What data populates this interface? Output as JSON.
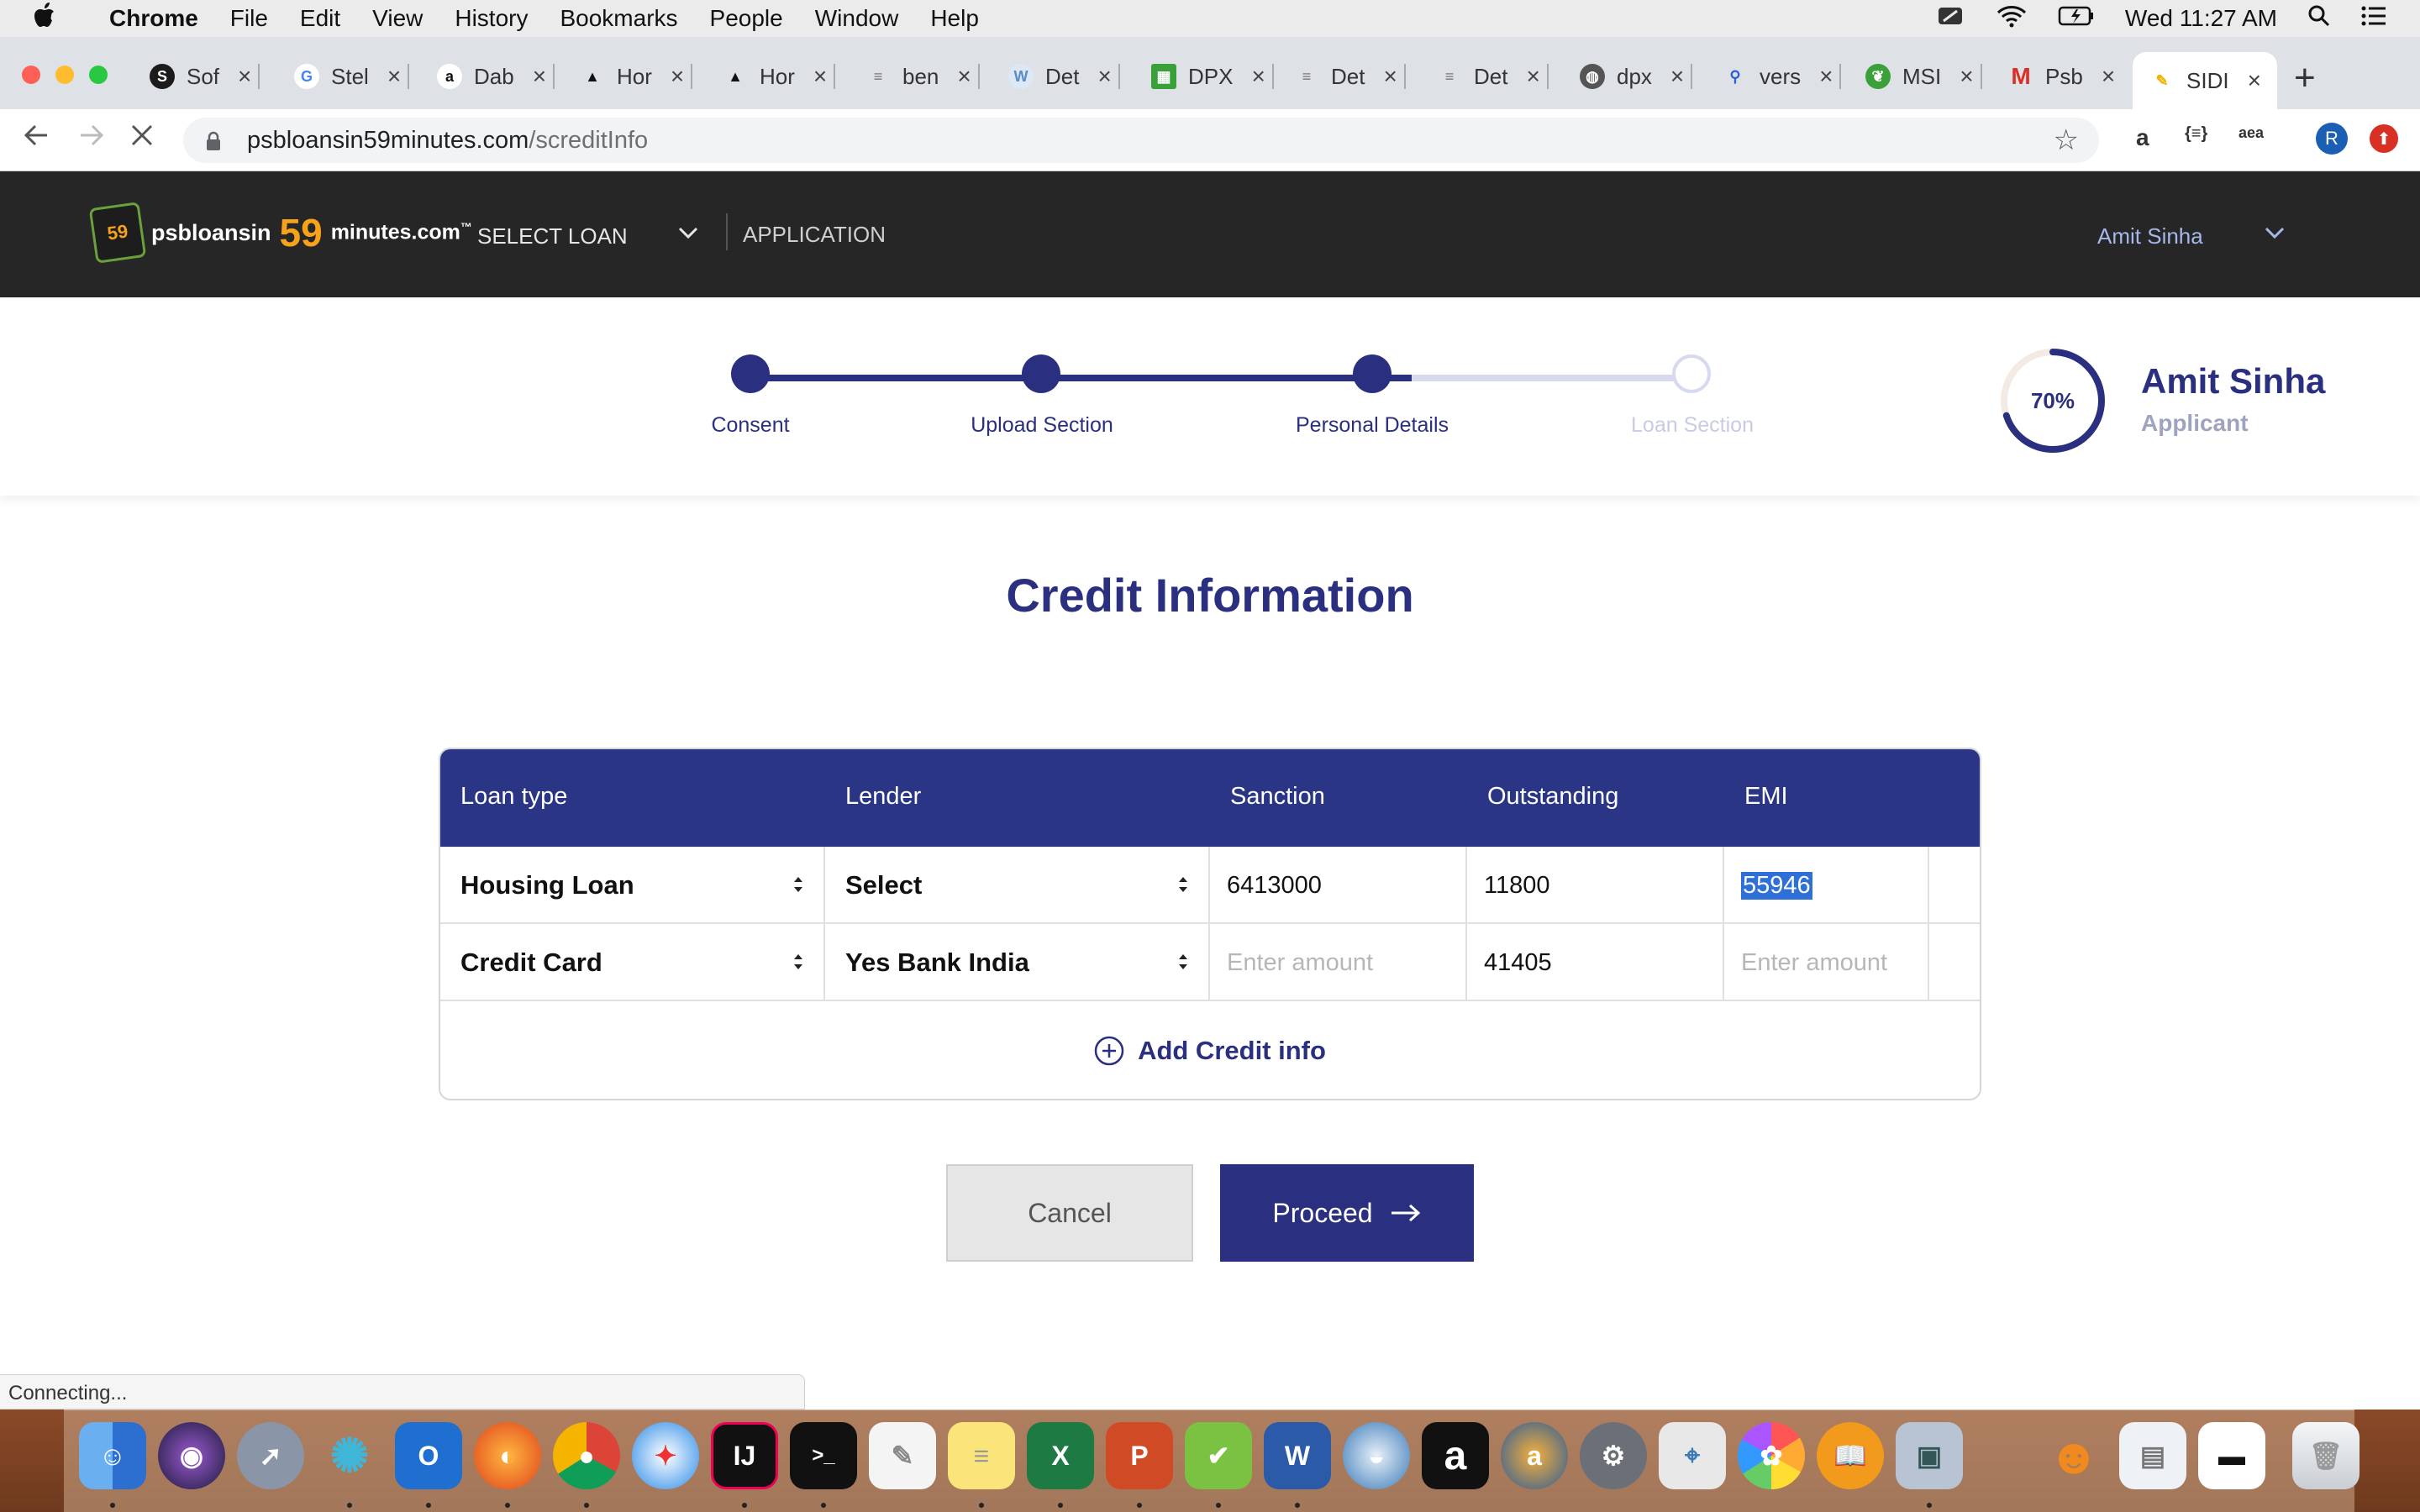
{
  "menubar": {
    "app_name": "Chrome",
    "items": [
      "File",
      "Edit",
      "View",
      "History",
      "Bookmarks",
      "People",
      "Window",
      "Help"
    ],
    "clock": "Wed 11:27 AM"
  },
  "tabs": [
    {
      "label": "Sof",
      "favicon": "sas-icon",
      "color": "#1b1b1b"
    },
    {
      "label": "Stel",
      "favicon": "google-icon",
      "color": "#4285f4"
    },
    {
      "label": "Dab",
      "favicon": "amazon-icon",
      "color": "#111111"
    },
    {
      "label": "Hor",
      "favicon": "rocket-icon",
      "color": "#111111"
    },
    {
      "label": "Hor",
      "favicon": "rocket-icon",
      "color": "#111111"
    },
    {
      "label": "ben",
      "favicon": "doc-icon",
      "color": "#888888"
    },
    {
      "label": "Det",
      "favicon": "wiki-icon",
      "color": "#7aa7d8"
    },
    {
      "label": "DPX",
      "favicon": "grid-icon",
      "color": "#3aa03a"
    },
    {
      "label": "Det",
      "favicon": "doc-icon",
      "color": "#888888"
    },
    {
      "label": "Det",
      "favicon": "doc-icon",
      "color": "#888888"
    },
    {
      "label": "dpx",
      "favicon": "globe-icon",
      "color": "#555555"
    },
    {
      "label": "vers",
      "favicon": "search-icon",
      "color": "#2a5fd8"
    },
    {
      "label": "MSI",
      "favicon": "leaf-icon",
      "color": "#3aa03a"
    },
    {
      "label": "Psb",
      "favicon": "gmail-icon",
      "color": "#d93025"
    },
    {
      "label": "SIDI",
      "favicon": "pen-icon",
      "color": "#f0b400"
    }
  ],
  "address_bar": {
    "host": "psbloansin59minutes.com",
    "path": "/screditInfo"
  },
  "extensions": [
    "a",
    "{≡}",
    "aea"
  ],
  "profile_initial": "R",
  "site": {
    "logo": {
      "badge": "59",
      "text1": "psbloansin",
      "number": "59",
      "text2": "minutes.com",
      "tm": "™"
    },
    "nav_select_loan": "SELECT LOAN",
    "nav_application": "APPLICATION",
    "user_name": "Amit Sinha"
  },
  "progress": {
    "steps": [
      {
        "label": "Consent",
        "state": "done"
      },
      {
        "label": "Upload Section",
        "state": "done"
      },
      {
        "label": "Personal Details",
        "state": "done"
      },
      {
        "label": "Loan Section",
        "state": "pending"
      }
    ],
    "percent_text": "70%",
    "percent_value": 0.7,
    "applicant_name": "Amit Sinha",
    "applicant_role": "Applicant"
  },
  "page_title": "Credit Information",
  "table": {
    "headers": [
      "Loan type",
      "Lender",
      "Sanction",
      "Outstanding",
      "EMI"
    ],
    "rows": [
      {
        "loan_type": "Housing Loan",
        "lender": "Select",
        "sanction": "6413000",
        "outstanding": "11800",
        "emi": "55946"
      },
      {
        "loan_type": "Credit Card",
        "lender": "Yes Bank India",
        "sanction": "",
        "outstanding": "41405",
        "emi": ""
      }
    ],
    "amount_placeholder": "Enter amount",
    "add_label": "Add Credit info"
  },
  "buttons": {
    "cancel": "Cancel",
    "proceed": "Proceed"
  },
  "status_text": "Connecting...",
  "colors": {
    "brand_navy": "#2a2f7f",
    "header_dark": "#262626",
    "accent_orange": "#f7a21b"
  }
}
